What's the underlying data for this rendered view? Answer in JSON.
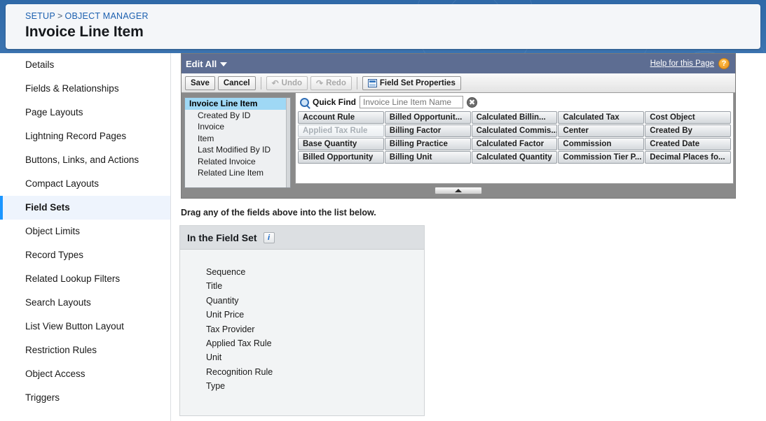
{
  "header": {
    "breadcrumb": {
      "setup": "SETUP",
      "separator": ">",
      "object_manager": "OBJECT MANAGER"
    },
    "title": "Invoice Line Item"
  },
  "sidebar": {
    "items": [
      {
        "label": "Details",
        "active": false
      },
      {
        "label": "Fields & Relationships",
        "active": false
      },
      {
        "label": "Page Layouts",
        "active": false
      },
      {
        "label": "Lightning Record Pages",
        "active": false
      },
      {
        "label": "Buttons, Links, and Actions",
        "active": false
      },
      {
        "label": "Compact Layouts",
        "active": false
      },
      {
        "label": "Field Sets",
        "active": true
      },
      {
        "label": "Object Limits",
        "active": false
      },
      {
        "label": "Record Types",
        "active": false
      },
      {
        "label": "Related Lookup Filters",
        "active": false
      },
      {
        "label": "Search Layouts",
        "active": false
      },
      {
        "label": "List View Button Layout",
        "active": false
      },
      {
        "label": "Restriction Rules",
        "active": false
      },
      {
        "label": "Object Access",
        "active": false
      },
      {
        "label": "Triggers",
        "active": false
      }
    ]
  },
  "editor": {
    "mode_label": "Edit All",
    "help_link": "Help for this Page",
    "help_badge": "?",
    "toolbar": {
      "save": "Save",
      "cancel": "Cancel",
      "undo": "Undo",
      "redo": "Redo",
      "field_set_properties": "Field Set Properties"
    },
    "object_tree": [
      {
        "label": "Invoice Line Item",
        "root": true
      },
      {
        "label": "Created By ID",
        "root": false
      },
      {
        "label": "Invoice",
        "root": false
      },
      {
        "label": "Item",
        "root": false
      },
      {
        "label": "Last Modified By ID",
        "root": false
      },
      {
        "label": "Related Invoice",
        "root": false
      },
      {
        "label": "Related Line Item",
        "root": false
      }
    ],
    "quick_find": {
      "label": "Quick Find",
      "placeholder": "Invoice Line Item Name",
      "value": "",
      "clear_icon": "✖"
    },
    "palette_fields": [
      {
        "label": "Account Rule",
        "used": false
      },
      {
        "label": "Billed Opportunit...",
        "used": false
      },
      {
        "label": "Calculated Billin...",
        "used": false
      },
      {
        "label": "Calculated Tax",
        "used": false
      },
      {
        "label": "Cost Object",
        "used": false
      },
      {
        "label": "Applied Tax Rule",
        "used": true
      },
      {
        "label": "Billing Factor",
        "used": false
      },
      {
        "label": "Calculated Commis...",
        "used": false
      },
      {
        "label": "Center",
        "used": false
      },
      {
        "label": "Created By",
        "used": false
      },
      {
        "label": "Base Quantity",
        "used": false
      },
      {
        "label": "Billing Practice",
        "used": false
      },
      {
        "label": "Calculated Factor",
        "used": false
      },
      {
        "label": "Commission",
        "used": false
      },
      {
        "label": "Created Date",
        "used": false
      },
      {
        "label": "Billed Opportunity",
        "used": false
      },
      {
        "label": "Billing Unit",
        "used": false
      },
      {
        "label": "Calculated Quantity",
        "used": false
      },
      {
        "label": "Commission Tier P...",
        "used": false
      },
      {
        "label": "Decimal Places fo...",
        "used": false
      }
    ]
  },
  "field_set": {
    "drag_hint": "Drag any of the fields above into the list below.",
    "title": "In the Field Set",
    "info_icon": "i",
    "fields": [
      {
        "label": "Sequence"
      },
      {
        "label": "Title"
      },
      {
        "label": "Quantity"
      },
      {
        "label": "Unit Price"
      },
      {
        "label": "Tax Provider"
      },
      {
        "label": "Applied Tax Rule"
      },
      {
        "label": "Unit"
      },
      {
        "label": "Recognition Rule"
      },
      {
        "label": "Type"
      }
    ]
  },
  "colors": {
    "accent_blue": "#1b96ff",
    "link_blue": "#1c60b0",
    "panel_header": "#5d6d92",
    "help_badge_orange": "#e8901b",
    "selected_row": "#9fd8f5"
  }
}
